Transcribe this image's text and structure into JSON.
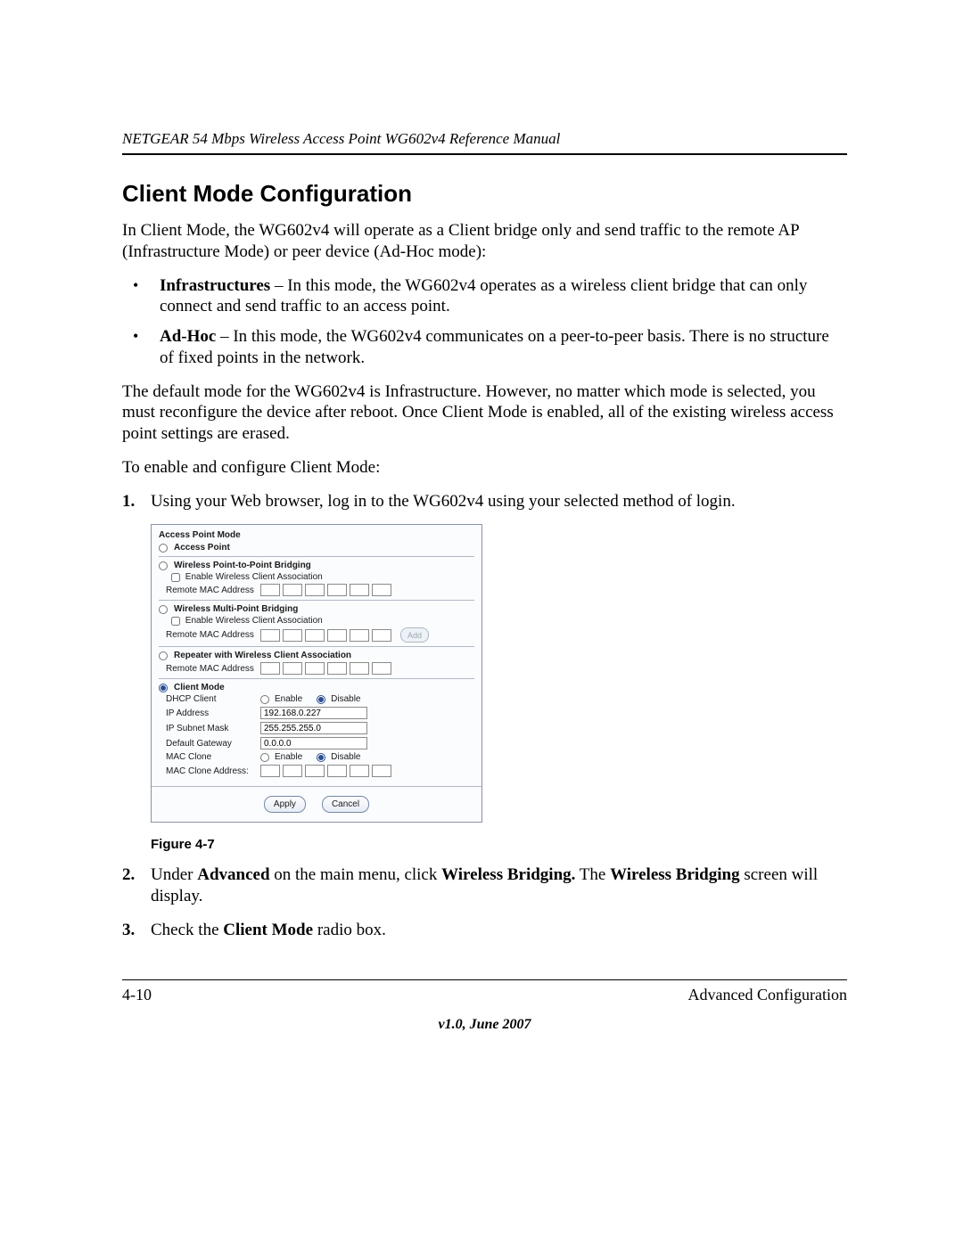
{
  "header": {
    "running_title": "NETGEAR 54 Mbps Wireless Access Point WG602v4 Reference Manual"
  },
  "section": {
    "title": "Client Mode Configuration",
    "intro": "In Client Mode, the WG602v4 will operate as a Client bridge only and send traffic to the remote AP (Infrastructure Mode) or peer device (Ad-Hoc mode):",
    "bullets": [
      {
        "lead": "Infrastructures",
        "text": " – In this mode, the WG602v4 operates as a wireless client bridge that can only connect and send traffic to an access point."
      },
      {
        "lead": "Ad-Hoc",
        "text": " – In this mode, the WG602v4 communicates on a peer-to-peer basis. There is no structure of fixed points in the network."
      }
    ],
    "para_default": "The default mode for the WG602v4 is Infrastructure. However, no matter which mode is selected, you must reconfigure the device after reboot. Once Client Mode is enabled, all of the existing wireless access point settings are erased.",
    "para_enable": "To enable and configure Client Mode:",
    "step1": "Using your Web browser, log in to the WG602v4 using your selected method of login.",
    "step2_pre": "Under ",
    "step2_b1": "Advanced",
    "step2_mid1": " on the main menu, click ",
    "step2_b2": "Wireless Bridging.",
    "step2_mid2": " The ",
    "step2_b3": "Wireless Bridging",
    "step2_post": " screen will display.",
    "step3_pre": "Check the ",
    "step3_b": "Client Mode",
    "step3_post": " radio box."
  },
  "figure": {
    "caption": "Figure 4-7",
    "shot": {
      "heading": "Access Point Mode",
      "mode_ap": "Access Point",
      "mode_ptp": "Wireless Point-to-Point Bridging",
      "mode_mpt": "Wireless Multi-Point Bridging",
      "mode_rep": "Repeater with Wireless Client Association",
      "mode_client": "Client Mode",
      "enable_wca": "Enable Wireless Client Association",
      "remote_mac": "Remote MAC Address",
      "add_btn": "Add",
      "dhcp_label": "DHCP Client",
      "enable": "Enable",
      "disable": "Disable",
      "ip_label": "IP Address",
      "ip_value": "192.168.0.227",
      "mask_label": "IP Subnet Mask",
      "mask_value": "255.255.255.0",
      "gw_label": "Default Gateway",
      "gw_value": "0.0.0.0",
      "macclone_label": "MAC Clone",
      "macclone_addr_label": "MAC Clone Address:",
      "apply": "Apply",
      "cancel": "Cancel"
    }
  },
  "footer": {
    "page_num": "4-10",
    "section": "Advanced Configuration",
    "version": "v1.0, June 2007"
  }
}
